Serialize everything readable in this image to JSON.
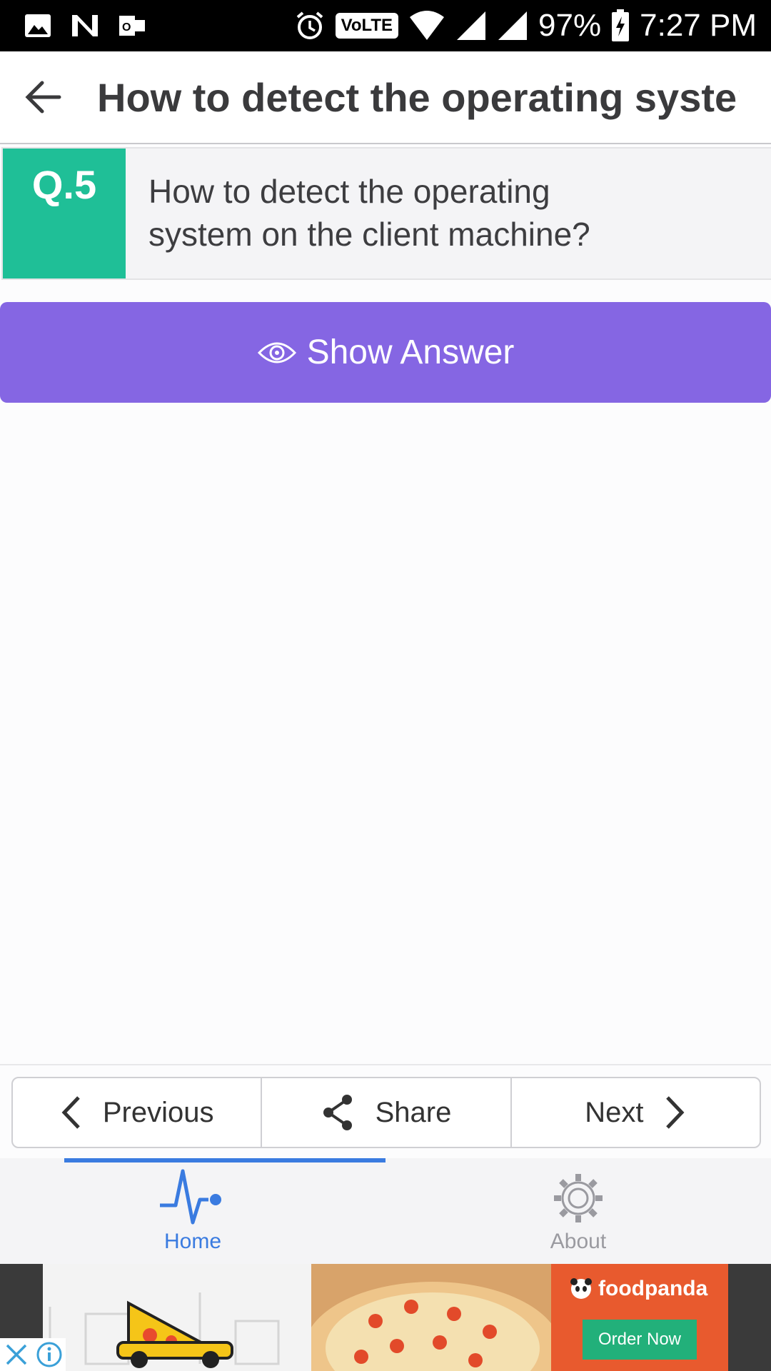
{
  "status_bar": {
    "battery": "97%",
    "time": "7:27 PM",
    "network_badge": "VoLTE"
  },
  "app_bar": {
    "title": "How to detect the operating system"
  },
  "question": {
    "number_label": "Q.5",
    "text": "How to detect the operating system on the client machine?"
  },
  "actions": {
    "show_answer_label": "Show Answer"
  },
  "navigation": {
    "previous_label": "Previous",
    "share_label": "Share",
    "next_label": "Next"
  },
  "bottom_tabs": [
    {
      "label": "Home",
      "icon": "pulse-icon",
      "active": true
    },
    {
      "label": "About",
      "icon": "gear-icon",
      "active": false
    }
  ],
  "ad": {
    "brand": "foodpanda",
    "cta": "Order Now"
  },
  "colors": {
    "badge_green": "#1fbf97",
    "show_answer_purple": "#8566e3",
    "active_tab_blue": "#3a7be0",
    "ad_orange": "#e85a2e"
  }
}
